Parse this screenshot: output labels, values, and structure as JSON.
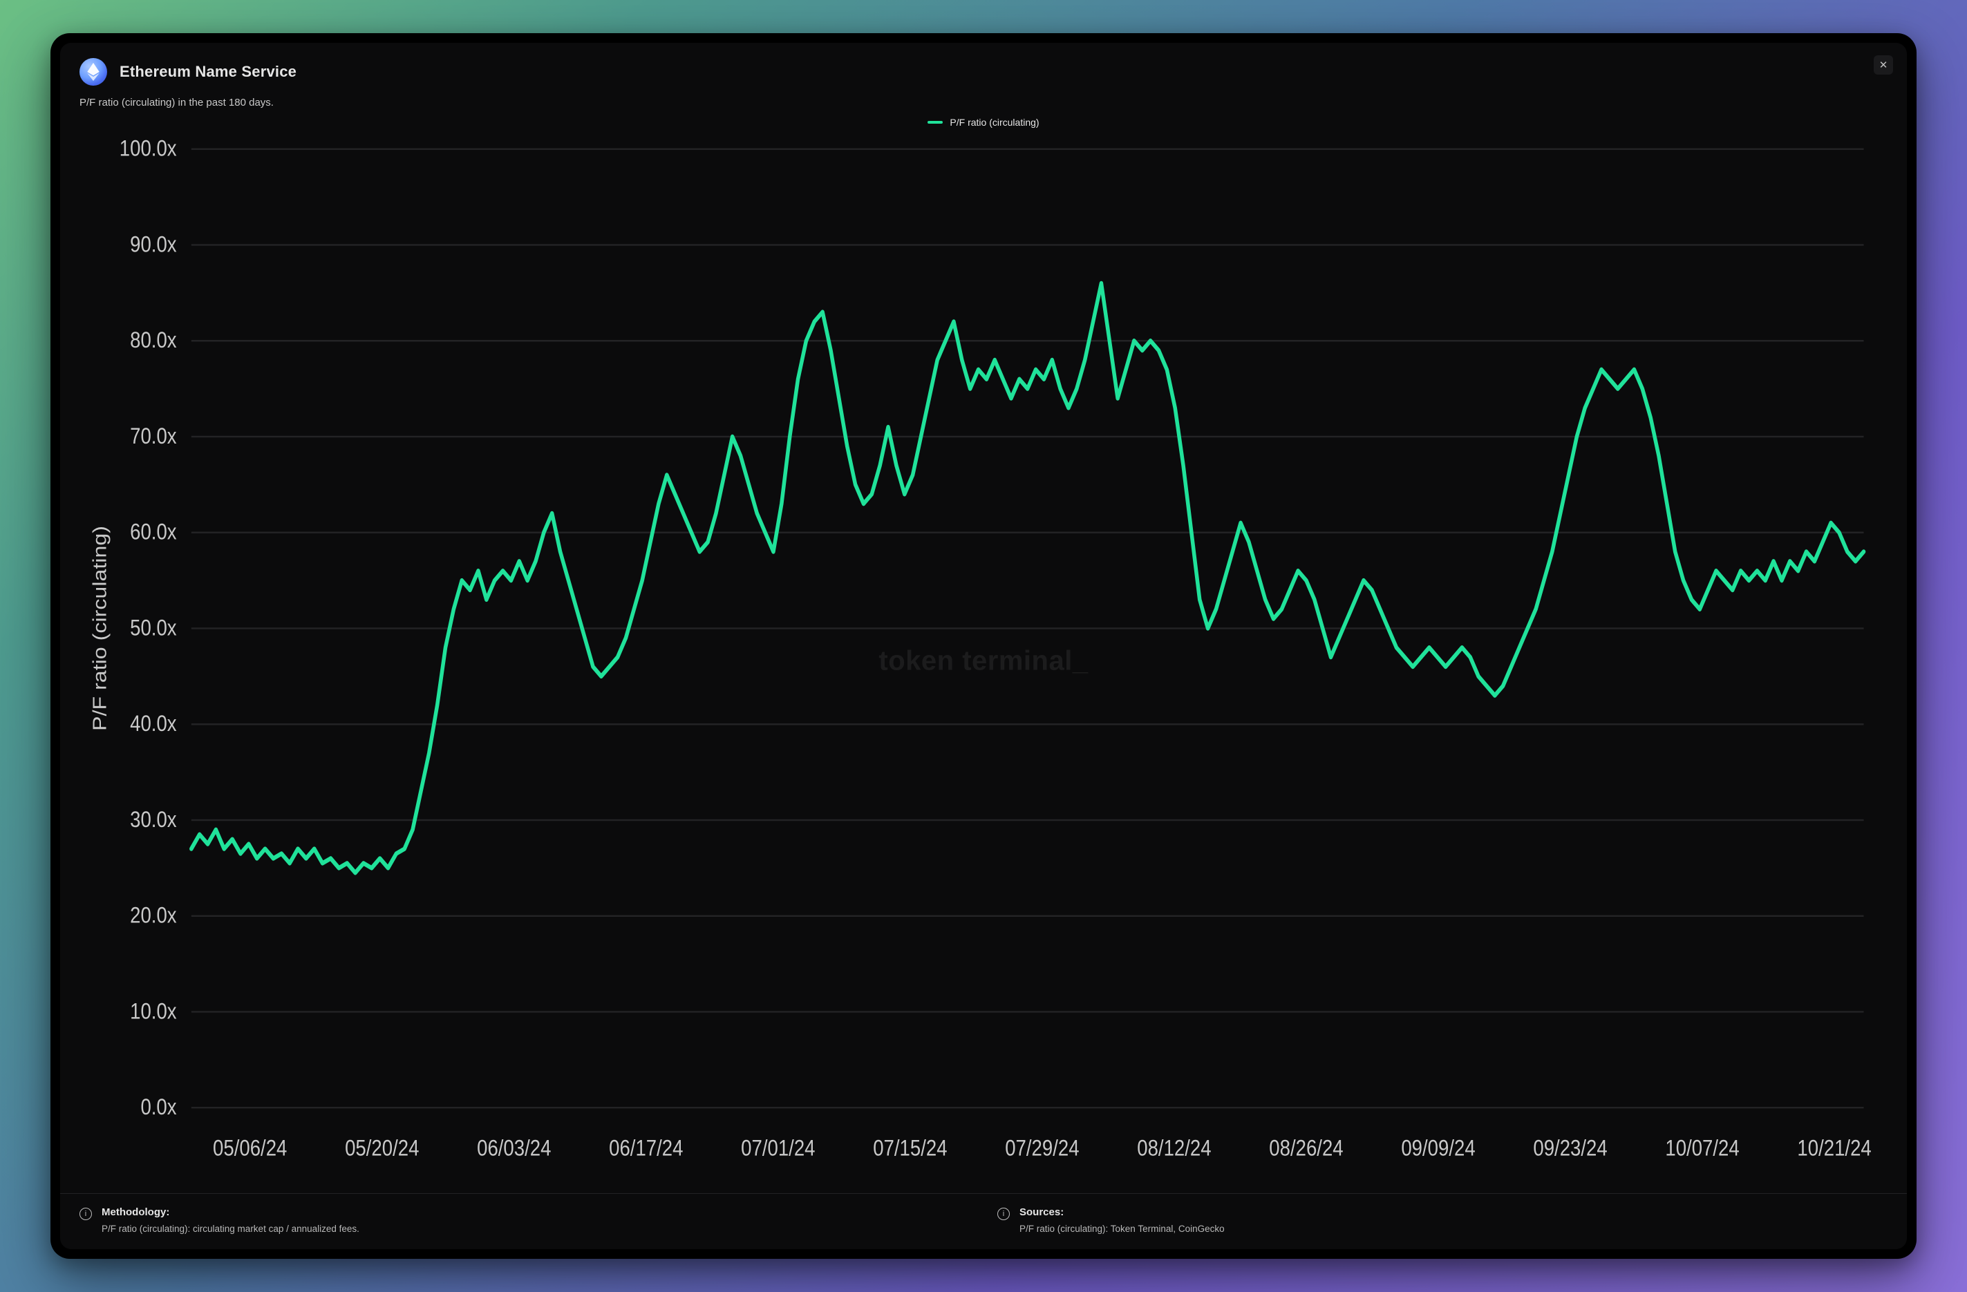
{
  "header": {
    "title": "Ethereum Name Service",
    "close_aria": "Close"
  },
  "subtitle": "P/F ratio (circulating) in the past 180 days.",
  "legend": {
    "series_label": "P/F ratio (circulating)"
  },
  "watermark": "token terminal_",
  "footer": {
    "methodology_label": "Methodology:",
    "methodology_text": "P/F ratio (circulating): circulating market cap / annualized fees.",
    "sources_label": "Sources:",
    "sources_text": "P/F ratio (circulating): Token Terminal, CoinGecko"
  },
  "colors": {
    "line": "#20e29a",
    "grid": "#232325",
    "axis_text": "#c9c9c9",
    "bg": "#0b0b0c"
  },
  "chart_data": {
    "type": "line",
    "title": "P/F ratio (circulating) in the past 180 days.",
    "xlabel": "",
    "ylabel": "P/F ratio (circulating)",
    "ylim": [
      0,
      100
    ],
    "y_ticks": [
      "0.0x",
      "10.0x",
      "20.0x",
      "30.0x",
      "40.0x",
      "50.0x",
      "60.0x",
      "70.0x",
      "80.0x",
      "90.0x",
      "100.0x"
    ],
    "x_ticks": [
      "05/06/24",
      "05/20/24",
      "06/03/24",
      "06/17/24",
      "07/01/24",
      "07/15/24",
      "07/29/24",
      "08/12/24",
      "08/26/24",
      "09/09/24",
      "09/23/24",
      "10/07/24",
      "10/21/24"
    ],
    "series": [
      {
        "name": "P/F ratio (circulating)",
        "color": "#20e29a",
        "values": [
          27,
          28.5,
          27.5,
          29,
          27,
          28,
          26.5,
          27.5,
          26,
          27,
          26,
          26.5,
          25.5,
          27,
          26,
          27,
          25.5,
          26,
          25,
          25.5,
          24.5,
          25.5,
          25,
          26,
          25,
          26.5,
          27,
          29,
          33,
          37,
          42,
          48,
          52,
          55,
          54,
          56,
          53,
          55,
          56,
          55,
          57,
          55,
          57,
          60,
          62,
          58,
          55,
          52,
          49,
          46,
          45,
          46,
          47,
          49,
          52,
          55,
          59,
          63,
          66,
          64,
          62,
          60,
          58,
          59,
          62,
          66,
          70,
          68,
          65,
          62,
          60,
          58,
          63,
          70,
          76,
          80,
          82,
          83,
          79,
          74,
          69,
          65,
          63,
          64,
          67,
          71,
          67,
          64,
          66,
          70,
          74,
          78,
          80,
          82,
          78,
          75,
          77,
          76,
          78,
          76,
          74,
          76,
          75,
          77,
          76,
          78,
          75,
          73,
          75,
          78,
          82,
          86,
          80,
          74,
          77,
          80,
          79,
          80,
          79,
          77,
          73,
          67,
          60,
          53,
          50,
          52,
          55,
          58,
          61,
          59,
          56,
          53,
          51,
          52,
          54,
          56,
          55,
          53,
          50,
          47,
          49,
          51,
          53,
          55,
          54,
          52,
          50,
          48,
          47,
          46,
          47,
          48,
          47,
          46,
          47,
          48,
          47,
          45,
          44,
          43,
          44,
          46,
          48,
          50,
          52,
          55,
          58,
          62,
          66,
          70,
          73,
          75,
          77,
          76,
          75,
          76,
          77,
          75,
          72,
          68,
          63,
          58,
          55,
          53,
          52,
          54,
          56,
          55,
          54,
          56,
          55,
          56,
          55,
          57,
          55,
          57,
          56,
          58,
          57,
          59,
          61,
          60,
          58,
          57,
          58
        ]
      }
    ]
  }
}
